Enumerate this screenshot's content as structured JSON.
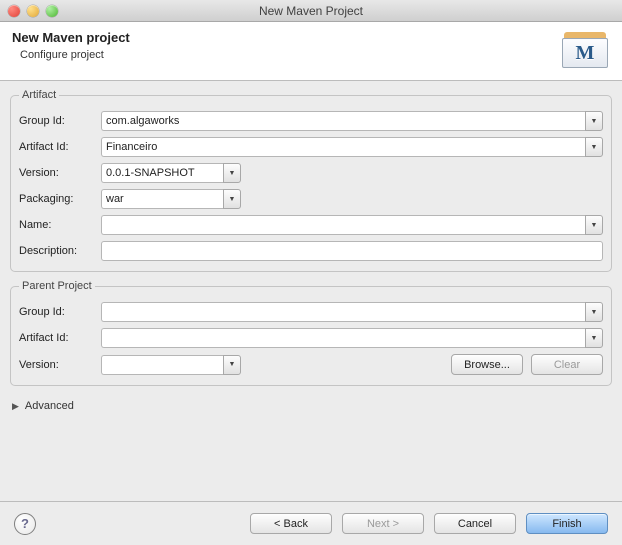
{
  "window": {
    "title": "New Maven Project"
  },
  "header": {
    "title": "New Maven project",
    "subtitle": "Configure project",
    "icon_letter": "M"
  },
  "artifact": {
    "legend": "Artifact",
    "labels": {
      "group_id": "Group Id:",
      "artifact_id": "Artifact Id:",
      "version": "Version:",
      "packaging": "Packaging:",
      "name": "Name:",
      "description": "Description:"
    },
    "values": {
      "group_id": "com.algaworks",
      "artifact_id": "Financeiro",
      "version": "0.0.1-SNAPSHOT",
      "packaging": "war",
      "name": "",
      "description": ""
    }
  },
  "parent": {
    "legend": "Parent Project",
    "labels": {
      "group_id": "Group Id:",
      "artifact_id": "Artifact Id:",
      "version": "Version:"
    },
    "values": {
      "group_id": "",
      "artifact_id": "",
      "version": ""
    },
    "buttons": {
      "browse": "Browse...",
      "clear": "Clear"
    }
  },
  "advanced": {
    "label": "Advanced"
  },
  "footer": {
    "back": "< Back",
    "next": "Next >",
    "cancel": "Cancel",
    "finish": "Finish"
  }
}
